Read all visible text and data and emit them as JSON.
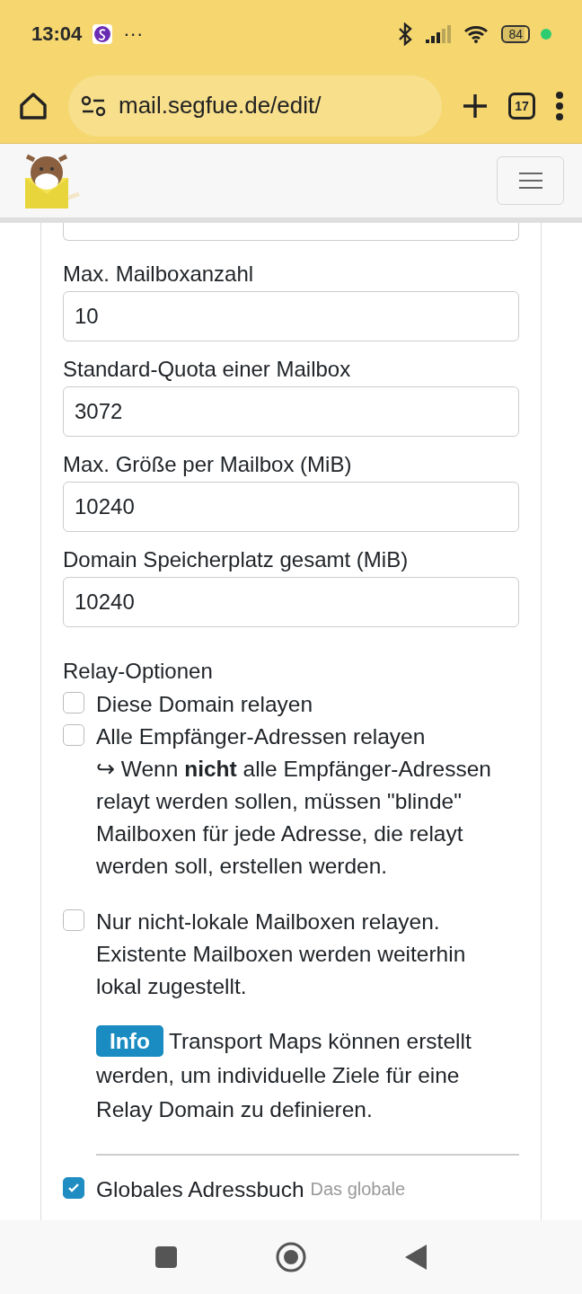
{
  "status_bar": {
    "time": "13:04",
    "more": "···",
    "battery": "84"
  },
  "browser": {
    "url": "mail.segfue.de/edit/",
    "tab_count": "17"
  },
  "form": {
    "fields": [
      {
        "label": "Max. Mailboxanzahl",
        "value": "10"
      },
      {
        "label": "Standard-Quota einer Mailbox",
        "value": "3072"
      },
      {
        "label": "Max. Größe per Mailbox (MiB)",
        "value": "10240"
      },
      {
        "label": "Domain Speicherplatz gesamt (MiB)",
        "value": "10240"
      }
    ],
    "relay_title": "Relay-Optionen",
    "relay_options": [
      {
        "label": "Diese Domain relayen",
        "checked": false
      },
      {
        "label": "Alle Empfänger-Adressen relayen",
        "checked": false,
        "note": "↪ Wenn **nicht** alle Empfänger-Adressen relayt werden sollen, müssen \"blinde\" Mailboxen für jede Adresse, die relayt werden soll, erstellen werden."
      },
      {
        "label": "Nur nicht-lokale Mailboxen relayen. Existente Mailboxen werden weiterhin lokal zugestellt.",
        "checked": false
      }
    ],
    "info": {
      "badge": "Info",
      "text": "Transport Maps können erstellt werden, um individuelle Ziele für eine Relay Domain zu definieren."
    },
    "addressbook": {
      "label": "Globales Adressbuch",
      "hint": "Das globale",
      "checked": true
    }
  }
}
